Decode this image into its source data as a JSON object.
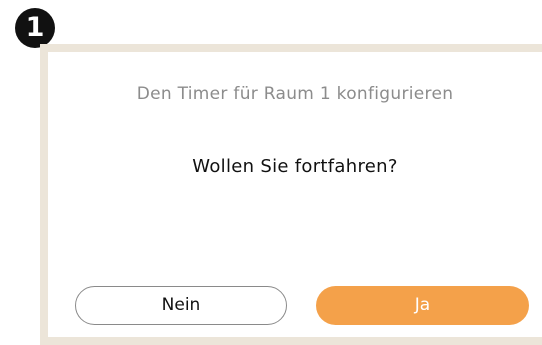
{
  "step": {
    "number": "1"
  },
  "dialog": {
    "title": "Den Timer für Raum 1 konfigurieren",
    "message": "Wollen Sie fortfahren?",
    "buttons": {
      "no_label": "Nein",
      "yes_label": "Ja"
    }
  },
  "colors": {
    "accent": "#f4a14a",
    "frame": "#ece5d9",
    "badge": "#111111"
  }
}
